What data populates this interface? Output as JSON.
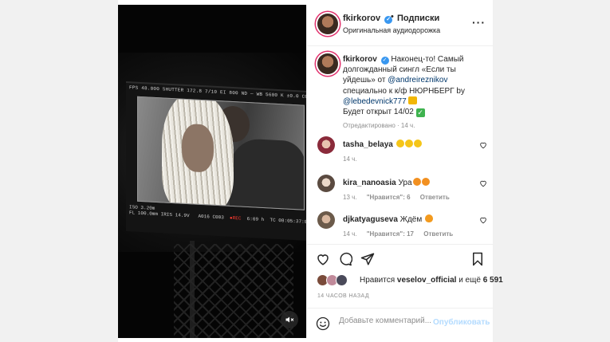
{
  "media": {
    "monitor_status": "FPS 48.000   SHUTTER 172.8   7/10   EI 800   ND —   WB 5600 K  ±0.0 CC",
    "monitor_bottom_left": "ISO 3.20m",
    "monitor_bottom_left2": "FL 100.0mm  IRIS 14.9V",
    "monitor_clip": "A016 C003",
    "monitor_rec": "●REC",
    "monitor_timer": "6:09 h",
    "monitor_tc": "TC 08:05:37:06"
  },
  "header": {
    "username": "fkirkorov",
    "separator": "•",
    "follow_label": "Подписки",
    "audio_label": "Оригинальная аудиодорожка",
    "more_label": "···"
  },
  "caption": {
    "username": "fkirkorov",
    "text_1": "Наконец-то! Самый долгожданный сингл «Если ты уйдешь» от",
    "mention_1": "@andreireznikov",
    "text_2": "специально к к/ф НЮРНБЕРГ by",
    "mention_2": "@lebedevnick777",
    "text_3": "Будет открыт 14/02",
    "check_emoji": "✓",
    "edited": "Отредактировано · 14 ч."
  },
  "comments": [
    {
      "username": "tasha_belaya",
      "text": "",
      "time": "14 ч.",
      "likes": "",
      "reply": ""
    },
    {
      "username": "kira_nanoasia",
      "text": "Ура",
      "time": "13 ч.",
      "likes": "\"Нравится\": 6",
      "reply": "Ответить"
    },
    {
      "username": "djkatyaguseva",
      "text": "Ждём",
      "time": "14 ч.",
      "likes": "\"Нравится\": 17",
      "reply": "Ответить"
    }
  ],
  "likes": {
    "prefix": "Нравится",
    "user": "veselov_official",
    "suffix": "и ещё",
    "count": "6 591"
  },
  "time_ago": "14 ЧАСОВ НАЗАД",
  "comment_box": {
    "placeholder": "Добавьте комментарий...",
    "publish_label": "Опубликовать"
  },
  "colors": {
    "link": "#00376b",
    "verified": "#3897f0",
    "publish_disabled": "#b3dbff",
    "story_ring": "#e1306c"
  },
  "icons": [
    "heart-icon",
    "comment-icon",
    "share-icon",
    "bookmark-icon",
    "smile-icon",
    "speaker-muted-icon",
    "verified-icon",
    "more-icon"
  ]
}
